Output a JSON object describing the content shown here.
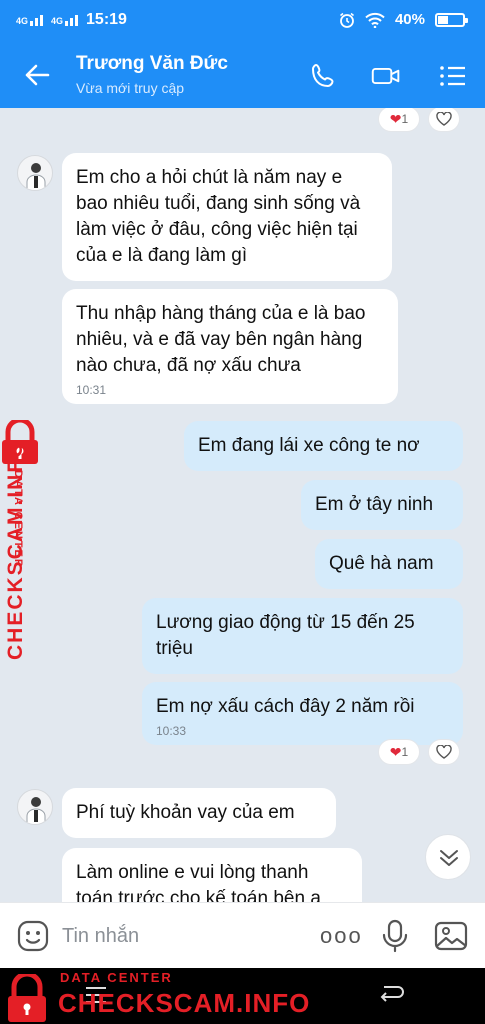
{
  "status_bar": {
    "signal_1": "4G",
    "signal_2": "4G",
    "time": "15:19",
    "battery": "40%",
    "battery_level": 0.4
  },
  "header": {
    "contact_name": "Trương Văn Đức",
    "presence": "Vừa mới truy cập"
  },
  "messages": [
    {
      "direction": "in",
      "text": "Em cho a hỏi chút là năm nay e bao nhiêu tuổi, đang sinh sống và làm việc ở đâu, công việc hiện tại của e là đang làm gì"
    },
    {
      "direction": "in",
      "text": "Thu nhập hàng tháng của e là bao nhiêu, và e đã vay bên ngân hàng nào chưa, đã nợ xấu chưa",
      "time": "10:31"
    },
    {
      "direction": "out",
      "text": "Em đang lái xe công te nơ"
    },
    {
      "direction": "out",
      "text": "Em ở tây ninh"
    },
    {
      "direction": "out",
      "text": "Quê hà nam"
    },
    {
      "direction": "out",
      "text": "Lương giao động từ 15 đến 25 triệu"
    },
    {
      "direction": "out",
      "text": "Em nợ xấu cách đây 2 năm rồi",
      "time": "10:33"
    },
    {
      "direction": "in",
      "text": "Phí tuỳ khoản vay của em"
    },
    {
      "direction": "in",
      "text": "Làm online e vui lòng thanh toán trước cho kế toán bên a"
    }
  ],
  "reactions": {
    "top_count": "1",
    "bottom_count": "1"
  },
  "input": {
    "placeholder": "Tin nhắn",
    "more": "ooo"
  },
  "watermark": {
    "sub": "DATA CENTER",
    "main": "CHECKSCAM.INFO"
  },
  "colors": {
    "header": "#1f8ef7",
    "outgoing_bubble": "#d5ebfb",
    "incoming_bubble": "#ffffff",
    "chat_background": "#e2e8ef",
    "watermark": "#e41f26"
  },
  "icons": [
    "back-arrow-icon",
    "phone-icon",
    "video-icon",
    "menu-icon",
    "heart-icon",
    "emoji-icon",
    "microphone-icon",
    "image-icon",
    "chevron-down-icon",
    "lock-icon"
  ]
}
